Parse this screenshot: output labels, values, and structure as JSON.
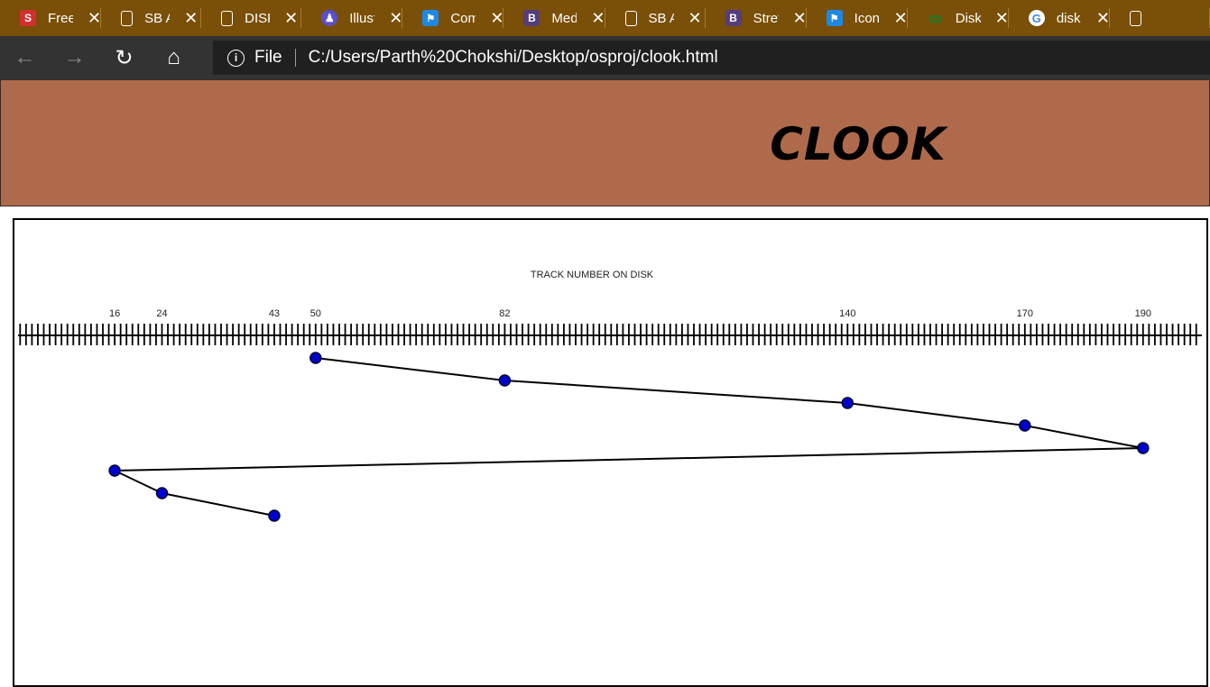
{
  "browser": {
    "tabs": [
      {
        "title": "Free I",
        "icon": "s-icon",
        "icon_text": "S"
      },
      {
        "title": "SB Ad",
        "icon": "document-icon",
        "icon_text": ""
      },
      {
        "title": "DISK",
        "icon": "document-icon",
        "icon_text": ""
      },
      {
        "title": "Illustr",
        "icon": "illustration-icon",
        "icon_text": "♟"
      },
      {
        "title": "Comp",
        "icon": "flag-icon",
        "icon_text": "⚑"
      },
      {
        "title": "Medi",
        "icon": "bootstrap-icon",
        "icon_text": "B"
      },
      {
        "title": "SB Ad",
        "icon": "document-icon",
        "icon_text": ""
      },
      {
        "title": "Stretc",
        "icon": "bootstrap-icon",
        "icon_text": "B"
      },
      {
        "title": "Icons",
        "icon": "flag-icon",
        "icon_text": "⚑"
      },
      {
        "title": "Disk",
        "icon": "disk-icon",
        "icon_text": "ꝏ"
      },
      {
        "title": "disk s",
        "icon": "google-icon",
        "icon_text": "G"
      },
      {
        "title": "",
        "icon": "document-icon",
        "icon_text": ""
      }
    ],
    "close_glyph": "✕",
    "nav": {
      "back": "←",
      "forward": "→",
      "refresh": "↻",
      "home": "⌂"
    },
    "address": {
      "scheme": "File",
      "url": "C:/Users/Parth%20Chokshi/Desktop/osproj/clook.html",
      "info_glyph": "i"
    }
  },
  "page": {
    "title": "CLOOK"
  },
  "chart_data": {
    "type": "line",
    "title": "TRACK NUMBER ON DISK",
    "xlabel": "TRACK NUMBER ON DISK",
    "tick_labels": [
      "16",
      "24",
      "43",
      "50",
      "82",
      "140",
      "170",
      "190"
    ],
    "x_range": [
      0,
      199
    ],
    "sequence": [
      50,
      82,
      140,
      170,
      190,
      16,
      24,
      43
    ],
    "series": [
      {
        "values": [
          50,
          82,
          140,
          170,
          190,
          16,
          24,
          43
        ]
      }
    ],
    "line_color": "#000000",
    "point_color": "#0000cc",
    "point_stroke": "#000033",
    "grid": false
  }
}
